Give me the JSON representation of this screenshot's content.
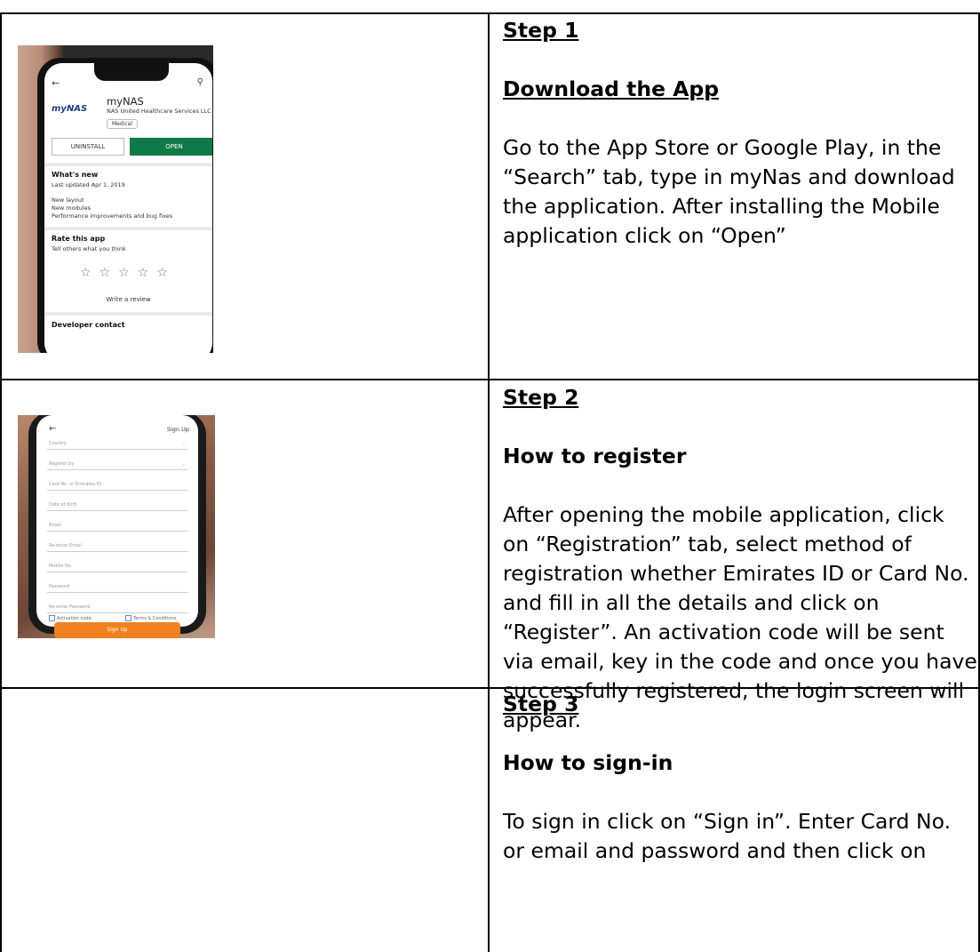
{
  "steps": [
    {
      "step": "Step 1",
      "heading": "Download the App",
      "body_lines": [
        "Go to the App Store or Google Play, in the",
        "“Search” tab, type in myNas and download",
        "the application. After installing the Mobile",
        "application click on “Open”"
      ]
    },
    {
      "step": "Step 2",
      "heading": "How to register",
      "body_lines": [
        "After opening the mobile application, click",
        "on “Registration” tab, select method of",
        "registration whether Emirates ID or Card No.",
        "and fill in all the details and click on",
        "“Register”. An activation code will be sent",
        "via email, key in the code and once you have",
        "successfully registered, the login screen will",
        "appear."
      ]
    },
    {
      "step": "Step 3",
      "heading": "How to sign-in",
      "body_lines": [
        "To sign in click on “Sign in”. Enter Card No.",
        "or email and password and then click on"
      ]
    }
  ],
  "phone1": {
    "app_name": "myNAS",
    "company": "NAS United Healthcare Services LLC",
    "logo": "myNAS",
    "category": "Medical",
    "uninstall": "UNINSTALL",
    "open": "OPEN",
    "whats_new": "What's new",
    "updated": "Last updated Apr 1, 2019",
    "changes": [
      "New layout",
      "New modules",
      "Performance improvements and bug fixes"
    ],
    "rate_title": "Rate this app",
    "rate_sub": "Tell others what you think",
    "write_review": "Write a review",
    "developer": "Developer contact"
  },
  "phone2": {
    "title": "Sign Up",
    "fields": [
      "Country",
      "Register by",
      "Card No. or Emirates ID",
      "Date of birth",
      "Email",
      "Re-enter Email",
      "Mobile No.",
      "Password",
      "Re-enter Password"
    ],
    "activation": "Activation code",
    "terms": "Terms & Conditions",
    "button": "Sign Up"
  }
}
